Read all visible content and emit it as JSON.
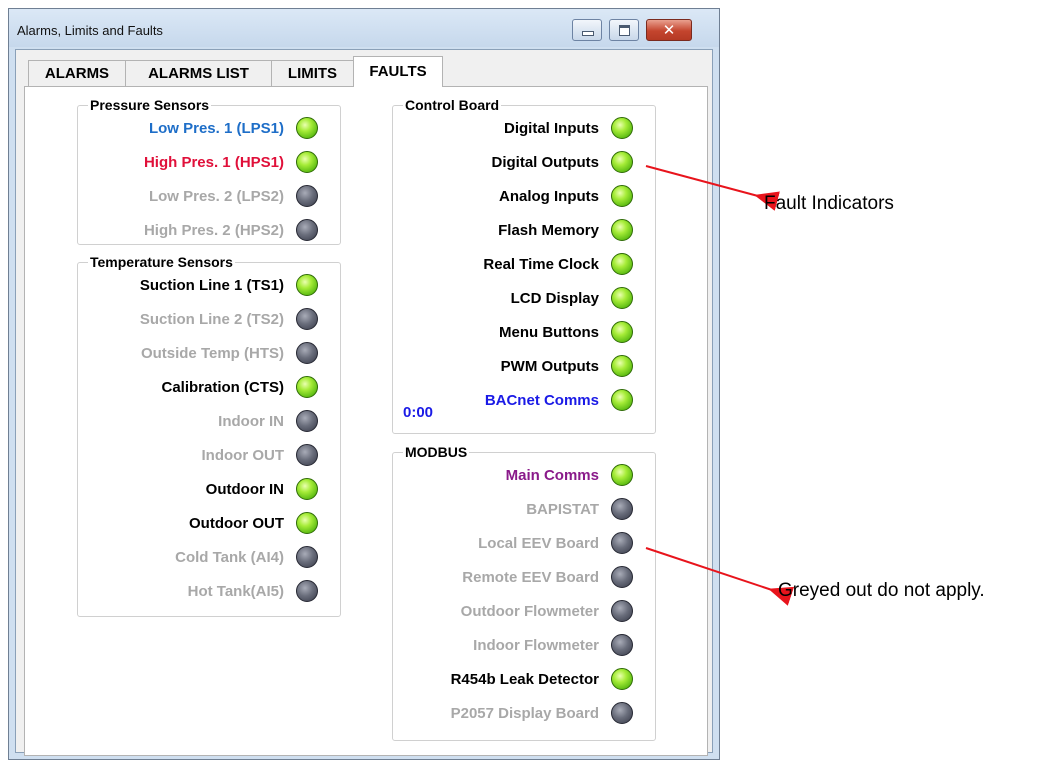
{
  "window": {
    "title": "Alarms, Limits and Faults",
    "buttons": {
      "minimize": "minimize-icon",
      "maximize": "maximize-icon",
      "close": "close-icon"
    }
  },
  "tabs": [
    {
      "label": "ALARMS",
      "active": false
    },
    {
      "label": "ALARMS LIST",
      "active": false
    },
    {
      "label": "LIMITS",
      "active": false
    },
    {
      "label": "FAULTS",
      "active": true
    }
  ],
  "pressure": {
    "title": "Pressure Sensors",
    "items": [
      {
        "label": "Low Pres. 1 (LPS1)",
        "state": "on",
        "color": "#1e6ec8"
      },
      {
        "label": "High Pres. 1 (HPS1)",
        "state": "on",
        "color": "#e0103a"
      },
      {
        "label": "Low Pres. 2 (LPS2)",
        "state": "off",
        "color": "#a8a8a8"
      },
      {
        "label": "High Pres. 2 (HPS2)",
        "state": "off",
        "color": "#a8a8a8"
      }
    ]
  },
  "temperature": {
    "title": "Temperature Sensors",
    "items": [
      {
        "label": "Suction Line 1 (TS1)",
        "state": "on",
        "color": "#000000"
      },
      {
        "label": "Suction Line 2 (TS2)",
        "state": "off",
        "color": "#a8a8a8"
      },
      {
        "label": "Outside Temp (HTS)",
        "state": "off",
        "color": "#a8a8a8"
      },
      {
        "label": "Calibration (CTS)",
        "state": "on",
        "color": "#000000"
      },
      {
        "label": "Indoor IN",
        "state": "off",
        "color": "#a8a8a8"
      },
      {
        "label": "Indoor OUT",
        "state": "off",
        "color": "#a8a8a8"
      },
      {
        "label": "Outdoor IN",
        "state": "on",
        "color": "#000000"
      },
      {
        "label": "Outdoor OUT",
        "state": "on",
        "color": "#000000"
      },
      {
        "label": "Cold Tank (AI4)",
        "state": "off",
        "color": "#a8a8a8"
      },
      {
        "label": "Hot Tank(AI5)",
        "state": "off",
        "color": "#a8a8a8"
      }
    ]
  },
  "control": {
    "title": "Control Board",
    "items": [
      {
        "label": "Digital Inputs",
        "state": "on",
        "color": "#000000"
      },
      {
        "label": "Digital Outputs",
        "state": "on",
        "color": "#000000"
      },
      {
        "label": "Analog Inputs",
        "state": "on",
        "color": "#000000"
      },
      {
        "label": "Flash Memory",
        "state": "on",
        "color": "#000000"
      },
      {
        "label": "Real Time Clock",
        "state": "on",
        "color": "#000000"
      },
      {
        "label": "LCD Display",
        "state": "on",
        "color": "#000000"
      },
      {
        "label": "Menu Buttons",
        "state": "on",
        "color": "#000000"
      },
      {
        "label": "PWM Outputs",
        "state": "on",
        "color": "#000000"
      },
      {
        "label": "BACnet Comms",
        "state": "on",
        "color": "#1a1ae6"
      }
    ],
    "bacnet_time": "0:00"
  },
  "modbus": {
    "title": "MODBUS",
    "items": [
      {
        "label": "Main Comms",
        "state": "on",
        "color": "#8a1a8a"
      },
      {
        "label": "BAPISTAT",
        "state": "off",
        "color": "#a8a8a8"
      },
      {
        "label": "Local EEV Board",
        "state": "off",
        "color": "#a8a8a8"
      },
      {
        "label": "Remote EEV Board",
        "state": "off",
        "color": "#a8a8a8"
      },
      {
        "label": "Outdoor Flowmeter",
        "state": "off",
        "color": "#a8a8a8"
      },
      {
        "label": "Indoor Flowmeter",
        "state": "off",
        "color": "#a8a8a8"
      },
      {
        "label": "R454b Leak Detector",
        "state": "on",
        "color": "#000000"
      },
      {
        "label": "P2057 Display Board",
        "state": "off",
        "color": "#a8a8a8"
      }
    ]
  },
  "annotations": [
    {
      "text": "Fault Indicators"
    },
    {
      "text": "Greyed out do not apply."
    }
  ],
  "colors": {
    "arrow": "#e8141c",
    "led_on": "#7fd11f",
    "led_off": "#5a5d6b",
    "greyed_text": "#a8a8a8"
  }
}
